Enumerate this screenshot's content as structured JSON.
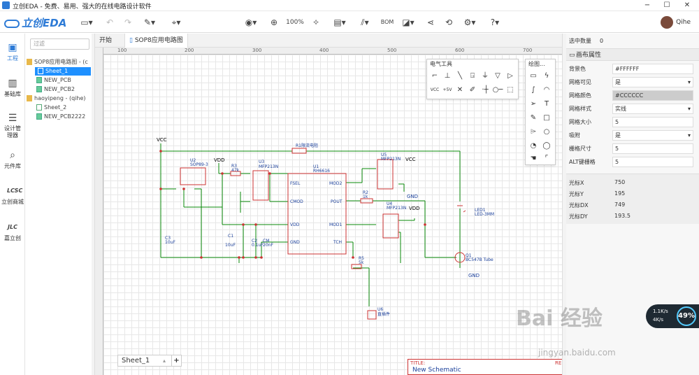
{
  "window": {
    "title": "立创EDA - 免费、易用、强大的在线电路设计软件",
    "minimize": "−",
    "maximize": "☐",
    "close": "✕"
  },
  "toolbar": {
    "logo": "立创EDA",
    "zoom": "100%",
    "bom": "BOM",
    "user": "Qihe",
    "icons": [
      "folder-icon",
      "undo-icon",
      "redo-icon",
      "pen-icon",
      "location-icon",
      "eye-icon",
      "zoom-in-icon",
      "magic-icon",
      "component-icon",
      "wiring-icon",
      "bom-icon",
      "layer-icon",
      "share-icon",
      "history-icon",
      "settings-icon",
      "help-icon"
    ]
  },
  "leftnav": {
    "items": [
      {
        "label": "工程"
      },
      {
        "label": "基础库"
      },
      {
        "label": "设计管理器"
      },
      {
        "label": "元件库"
      },
      {
        "label": "立创商城"
      },
      {
        "label": "嘉立创"
      }
    ]
  },
  "tree": {
    "filter_placeholder": "过滤",
    "nodes": [
      {
        "label": "SOP8应用电路图 - (c"
      },
      {
        "label": "Sheet_1"
      },
      {
        "label": "NEW_PCB"
      },
      {
        "label": "NEW_PCB2"
      },
      {
        "label": "haoyipeng - (qihe)"
      },
      {
        "label": "Sheet_2"
      },
      {
        "label": "NEW_PCB2222"
      }
    ]
  },
  "tabs": [
    {
      "label": "开始"
    },
    {
      "label": "SOP8应用电路图"
    }
  ],
  "ruler": {
    "marks": [
      "100",
      "200",
      "300",
      "400",
      "500",
      "600",
      "700"
    ]
  },
  "electric_panel": {
    "title": "电气工具"
  },
  "draw_panel": {
    "title": "绘图..."
  },
  "schematic": {
    "labels": {
      "vcc1": "VCC",
      "vdd1": "VDD",
      "vcc2": "VCC",
      "vdd2": "VDD",
      "gnd1": "GND",
      "gnd2": "GND",
      "r1": "R1",
      "r1v": "限流电阻",
      "r3": "R3",
      "r3v": "47k",
      "r2": "R2",
      "r2v": "1k",
      "r5": "R5",
      "r5v": "5k",
      "u1": "U1",
      "u1v": "RH6616",
      "u2": "U2",
      "u2v": "SOP89-3",
      "u3": "U3",
      "u3v": "MFP213N",
      "u4": "U4",
      "u4v": "MFP213N",
      "u5": "U5",
      "u5v": "MFP213N",
      "u6": "U6",
      "u6v": "直插件",
      "c1": "C1",
      "c1v": "10uF",
      "c2": "C2",
      "c2v": "0.1uF",
      "cm": "CM",
      "cmv": "20nF",
      "c3": "C3",
      "c3v": "10uF",
      "led": "LED1",
      "ledv": "LED-3MM",
      "q1": "Q1",
      "q1v": "BC547B Tube",
      "fsel": "FSEL",
      "cmod": "CMOD",
      "vdd": "VDD",
      "gnd": "GND",
      "mod2": "MOD2",
      "pout": "POUT",
      "mod1": "MOD1",
      "tch": "TCH",
      "vin": "Vin",
      "vout": "Vout",
      "vss": "Vss"
    }
  },
  "sheet_tab": {
    "label": "Sheet_1",
    "add": "+"
  },
  "title_block": {
    "title_label": "TITLE:",
    "title": "New Schematic",
    "right": "RE"
  },
  "props": {
    "selected_label": "选中数量",
    "selected_count": "0",
    "section": "画布属性",
    "rows": [
      {
        "k": "背景色",
        "v": "#FFFFFF"
      },
      {
        "k": "网格可见",
        "v": "是"
      },
      {
        "k": "网格颜色",
        "v": "#CCCCCC"
      },
      {
        "k": "网格样式",
        "v": "实线"
      },
      {
        "k": "网格大小",
        "v": "5"
      },
      {
        "k": "吸附",
        "v": "是"
      },
      {
        "k": "栅格尺寸",
        "v": "5"
      },
      {
        "k": "ALT键栅格",
        "v": "5"
      }
    ],
    "cursor": [
      {
        "k": "光标X",
        "v": "750"
      },
      {
        "k": "光标Y",
        "v": "195"
      },
      {
        "k": "光标DX",
        "v": "749"
      },
      {
        "k": "光标DY",
        "v": "193.5"
      }
    ]
  },
  "overlay": {
    "net_up": "1.1K/s",
    "net_down": "4K/s",
    "percent": "49%",
    "watermark": "Bai 经验",
    "watermark_url": "jingyan.baidu.com"
  }
}
